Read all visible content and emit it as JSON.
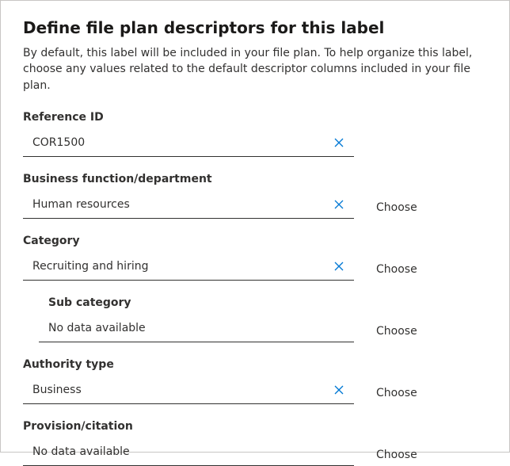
{
  "title": "Define file plan descriptors for this label",
  "description": "By default, this label will be included in your file plan. To help organize this label, choose any values related to the default descriptor columns included in your file plan.",
  "choose_label": "Choose",
  "fields": {
    "reference_id": {
      "label": "Reference ID",
      "value": "COR1500",
      "clearable": true,
      "has_choose": false,
      "indent": false
    },
    "business": {
      "label": "Business function/department",
      "value": "Human resources",
      "clearable": true,
      "has_choose": true,
      "indent": false
    },
    "category": {
      "label": "Category",
      "value": "Recruiting and hiring",
      "clearable": true,
      "has_choose": true,
      "indent": false
    },
    "subcategory": {
      "label": "Sub category",
      "value": "No data available",
      "clearable": false,
      "has_choose": true,
      "indent": true
    },
    "authority": {
      "label": "Authority type",
      "value": "Business",
      "clearable": true,
      "has_choose": true,
      "indent": false
    },
    "provision": {
      "label": "Provision/citation",
      "value": "No data available",
      "clearable": false,
      "has_choose": true,
      "indent": false
    }
  }
}
